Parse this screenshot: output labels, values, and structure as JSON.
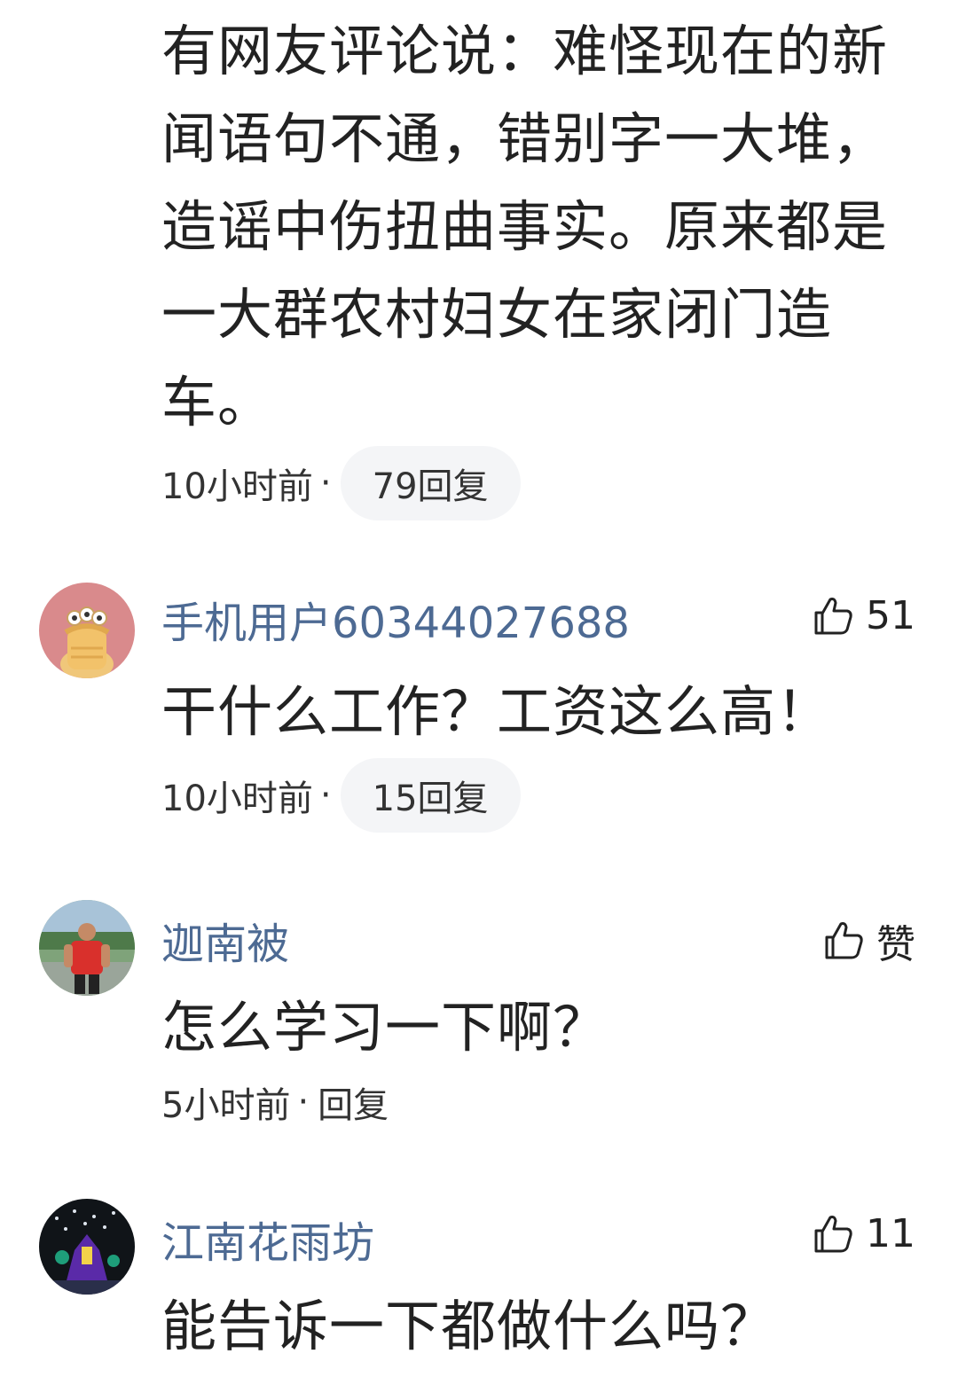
{
  "top_comment": {
    "text": "有网友评论说：难怪现在的新闻语句不通，错别字一大堆，造谣中伤扭曲事实。原来都是一大群农村妇女在家闭门造车。",
    "time": "10小时前",
    "dot": "·",
    "replies": "79回复"
  },
  "comments": [
    {
      "username": "手机用户60344027688",
      "likes": "51",
      "text": "干什么工作？工资这么高！",
      "time": "10小时前",
      "dot": "·",
      "replies": "15回复"
    },
    {
      "username": "迦南被",
      "likes": "赞",
      "text": "怎么学习一下啊？",
      "time": "5小时前",
      "dot": "·",
      "replies": "回复"
    },
    {
      "username": "江南花雨坊",
      "likes": "11",
      "text": "能告诉一下都做什么吗？"
    }
  ],
  "icons": {
    "like": "thumbs-up-icon"
  },
  "colors": {
    "username": "#4d6a93",
    "pill_bg": "#f4f5f7",
    "text": "#222222"
  }
}
